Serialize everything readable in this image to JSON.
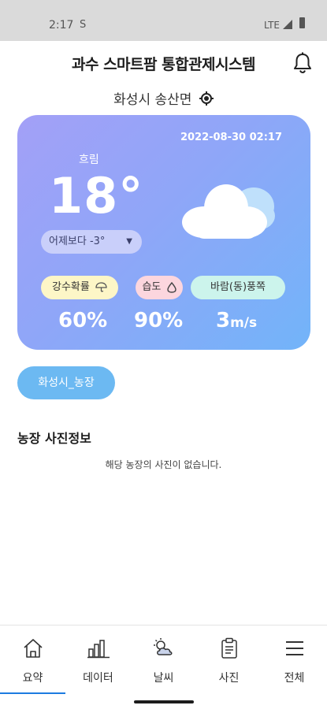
{
  "status_bar": {
    "time": "2:17",
    "sim_icon": "S",
    "network": "LTE"
  },
  "header": {
    "title": "과수 스마트팜 통합관제시스템"
  },
  "location": {
    "name": "화성시 송산면"
  },
  "weather": {
    "datetime": "2022-08-30 02:17",
    "condition": "흐림",
    "temperature": "18°",
    "compare": "어제보다 -3°",
    "rain_label": "강수확률",
    "humidity_label": "습도",
    "wind_label": "바람(동)풍쪽",
    "rain_value": "60%",
    "humidity_value": "90%",
    "wind_value": "3",
    "wind_unit": "m/s"
  },
  "farm_chip": {
    "label": "화성시_농장"
  },
  "photo_section": {
    "title": "농장 사진정보",
    "empty_message": "해당 농장의 사진이 없습니다."
  },
  "bottom_nav": {
    "items": [
      {
        "label": "요약",
        "icon": "home-icon"
      },
      {
        "label": "데이터",
        "icon": "bar-chart-icon"
      },
      {
        "label": "날씨",
        "icon": "weather-icon"
      },
      {
        "label": "사진",
        "icon": "clipboard-icon"
      },
      {
        "label": "전체",
        "icon": "menu-icon"
      }
    ],
    "active_index": 0
  },
  "colors": {
    "card_start": "#a3a0f7",
    "card_end": "#72b4f9",
    "chip": "#6cb9f2",
    "active": "#1c7be0"
  }
}
